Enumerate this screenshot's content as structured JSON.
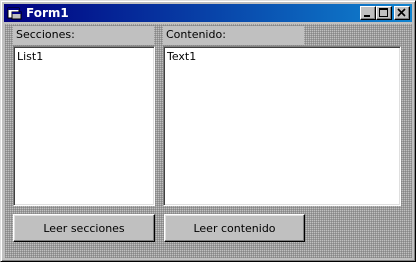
{
  "window": {
    "title": "Form1"
  },
  "titlebar": {
    "minimize_icon": "minimize-icon",
    "maximize_icon": "maximize-icon",
    "close_icon": "close-icon"
  },
  "secciones": {
    "label": "Secciones:",
    "list_items": [
      "List1"
    ]
  },
  "contenido": {
    "label": "Contenido:",
    "text": "Text1"
  },
  "buttons": {
    "leer_secciones": "Leer secciones",
    "leer_contenido": "Leer contenido"
  },
  "colors": {
    "titlebar_start": "#000080",
    "titlebar_end": "#1084d0",
    "face": "#c0c0c0"
  }
}
